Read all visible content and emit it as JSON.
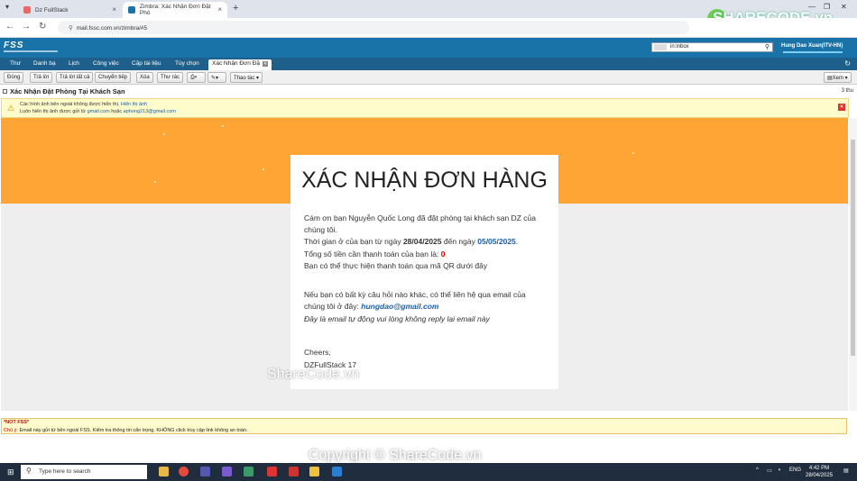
{
  "browser": {
    "tabs": [
      {
        "label": "Dz FullStack",
        "active": false
      },
      {
        "label": "Zimbra: Xác Nhận Đơn Đặt Phò",
        "active": true
      }
    ],
    "url": "mail.fssc.com.vn/zimbra/#5"
  },
  "zimbra": {
    "logo": "FSS",
    "search_value": "in:inbox",
    "user": "Hung Dao Xuan(ITV-HN)",
    "menu": [
      "Thư",
      "Danh bạ",
      "Lịch",
      "Công việc",
      "Cặp tài liệu",
      "Tùy chọn"
    ],
    "active_tab": "Xác Nhận Đơn Đặ",
    "toolbar": [
      "Đóng",
      "Trả lời",
      "Trả lời tất cả",
      "Chuyển tiếp",
      "Xóa",
      "Thư rác",
      "Thao tác",
      "Xem"
    ],
    "subject": "Xác Nhận Đặt Phòng Tại Khách Sạn",
    "time": "3 thu",
    "warning_line1": "Các hình ảnh bên ngoài không được hiển thị.",
    "warning_link1": "Hiển thị ảnh",
    "warning_line2_prefix": "Luôn hiển thị ảnh được gửi từ",
    "warning_link2a": "gmail.com",
    "warning_or": "hoặc",
    "warning_link2b": "aphong213@gmail.com"
  },
  "email": {
    "heading": "XÁC NHẬN ĐƠN HÀNG",
    "line1": "Cám ơn bạn Nguyễn Quốc Long đã đặt phòng tại khách sạn DZ của chúng tôi.",
    "time_prefix": "Thời gian ở của bạn từ ngày",
    "date_from": "28/04/2025",
    "time_mid": "đến ngày",
    "date_to": "05/05/2025",
    "total_prefix": "Tổng số tiền cần thanh toán của bạn là:",
    "total_value": "0",
    "qr_line": "Bạn có thể thực hiện thanh toán qua mã QR dưới đây",
    "contact_line": "Nếu bạn có bất kỳ câu hỏi nào khác, có thể liên hệ qua email của chúng tôi ở đây:",
    "contact_email": "hungdao@gmail.com",
    "auto_note": "Đây là email tự động vui lòng không reply lại email này",
    "signoff": "Cheers,",
    "signature": "DZFullStack 17"
  },
  "notice": {
    "title": "*NOT FSS*",
    "label": "Chú ý:",
    "text": "Email này gửi từ bên ngoài FSS. Kiểm tra thông tin cẩn trọng. KHÔNG click truy cập link không an toàn."
  },
  "watermarks": {
    "mid": "ShareCode.vn",
    "bottom": "Copyright © ShareCode.vn",
    "logo": "SHARECODE.vn"
  },
  "taskbar": {
    "search_placeholder": "Type here to search",
    "lang": "ENG",
    "time": "4:42 PM",
    "date": "28/04/2025"
  }
}
